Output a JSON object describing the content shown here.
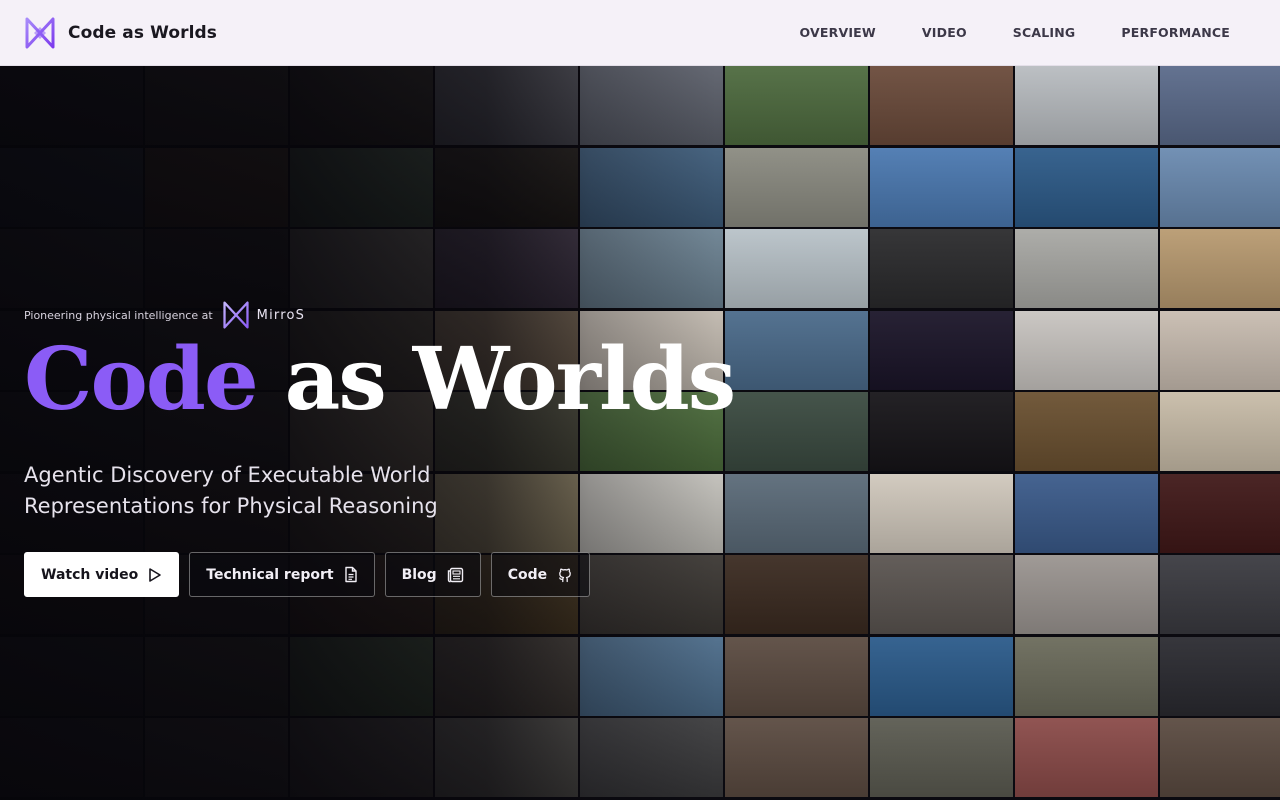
{
  "nav": {
    "brand": "Code as Worlds",
    "links": [
      "OVERVIEW",
      "VIDEO",
      "SCALING",
      "PERFORMANCE"
    ]
  },
  "hero": {
    "eyebrow": "Pioneering physical intelligence at",
    "partner": "MirroS",
    "title_highlight": "Code",
    "title_rest": "as Worlds",
    "subtitle": "Agentic Discovery of Executable World Representations for Physical Reasoning"
  },
  "actions": [
    {
      "label": "Watch video",
      "icon": "play-icon"
    },
    {
      "label": "Technical report",
      "icon": "document-icon"
    },
    {
      "label": "Blog",
      "icon": "news-icon"
    },
    {
      "label": "Code",
      "icon": "github-icon"
    }
  ],
  "colors": {
    "accent": "#8b5cf6",
    "nav_bg": "#f5f1f8",
    "hero_bg": "#0b0a10"
  },
  "mosaic": {
    "columns": 9,
    "rows": 9,
    "tile_colors": [
      "#2b2a2e",
      "#3a3630",
      "#2a2622",
      "#4a4a52",
      "#5b5f6a",
      "#4d6a3e",
      "#6a4a3a",
      "#b8bcc0",
      "#5a6a8a",
      "#2e3a44",
      "#4a3a28",
      "#3a4a3a",
      "#1e1a16",
      "#3c5a78",
      "#8a8a80",
      "#4a78b0",
      "#2c5a88",
      "#6a8ab0",
      "#3a3a3a",
      "#2a2624",
      "#5a5650",
      "#3a3040",
      "#6a8090",
      "#b8c2c8",
      "#2a2a2c",
      "#a8a8a4",
      "#b89a70",
      "#2a2a30",
      "#3a3834",
      "#4a4438",
      "#6a5a48",
      "#bfb7ad",
      "#4a6a8a",
      "#1a1428",
      "#c8c4c0",
      "#c8bcb0",
      "#2a2e2a",
      "#3a3632",
      "#6a6050",
      "#4a4a3a",
      "#4a6a3a",
      "#3a4a40",
      "#161418",
      "#6a5030",
      "#c8bca8",
      "#2a2628",
      "#3a3028",
      "#4a4034",
      "#8a7e60",
      "#c0beb8",
      "#5a6a78",
      "#d0c8bc",
      "#3a5a8a",
      "#401818",
      "#2a2220",
      "#38302c",
      "#3a2a1e",
      "#4a3a22",
      "#3a3632",
      "#3a2a20",
      "#5a5450",
      "#9a9490",
      "#3a3a40",
      "#2a2a2a",
      "#3a3830",
      "#3a4a34",
      "#403a34",
      "#4a6a88",
      "#5a4a40",
      "#2a5a8a",
      "#6a6a5a",
      "#2a2a30",
      "#2a2628",
      "#3a3634",
      "#3a3634",
      "#4a4844",
      "#3a3a3c",
      "#5a4a40",
      "#5a5a50",
      "#8a4a48",
      "#5a4a40"
    ]
  }
}
